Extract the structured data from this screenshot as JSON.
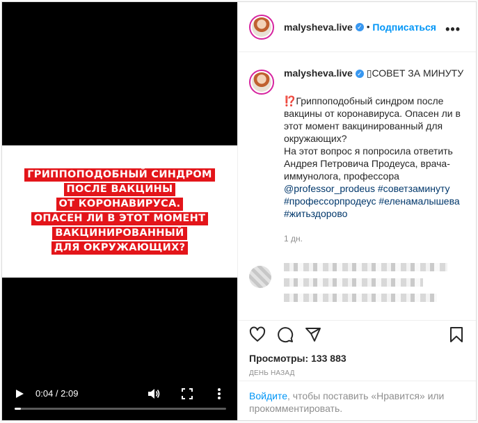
{
  "video": {
    "banner_lines": [
      "ГРИППОПОДОБНЫЙ СИНДРОМ",
      "ПОСЛЕ ВАКЦИНЫ",
      "ОТ КОРОНАВИРУСА.",
      "ОПАСЕН ЛИ В ЭТОТ МОМЕНТ",
      "ВАКЦИНИРОВАННЫЙ",
      "ДЛЯ ОКРУЖАЮЩИХ?"
    ],
    "time": "0:04 / 2:09",
    "progress_fraction": 0.031,
    "colors": {
      "banner": "#e3151a"
    }
  },
  "header": {
    "username": "malysheva.live",
    "verified": "✓",
    "separator": "•",
    "follow_label": "Подписаться",
    "more_label": "•••"
  },
  "caption": {
    "username": "malysheva.live",
    "title": " ▯СОВЕТ ЗА МИНУТУ",
    "body": "⁉️Гриппоподобный синдром после вакцины от коронавируса. Опасен ли в этот момент вакцинированный для окружающих?\nНа этот вопрос я попросила ответить Андрея Петровича Продеуса, врача-иммунолога, профессора ",
    "mention": "@professor_prodeus",
    "hashtags": "#советзаминуту #профессорпродеус #еленамалышева #житьздорово",
    "age": "1 дн."
  },
  "stats": {
    "views_label": "Просмотры:",
    "views_value": "133 883",
    "date": "День назад"
  },
  "login": {
    "link": "Войдите",
    "text": ", чтобы поставить «Нравится» или прокомментировать."
  },
  "icons": [
    "heart-icon",
    "comment-icon",
    "share-icon",
    "bookmark-icon",
    "play-icon",
    "volume-icon",
    "fullscreen-icon",
    "more-vertical-icon"
  ]
}
